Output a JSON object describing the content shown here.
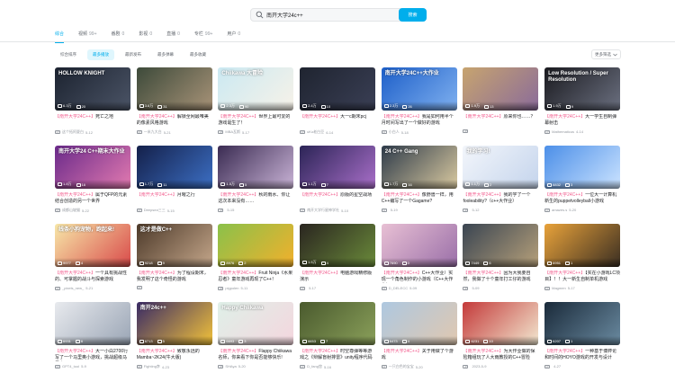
{
  "search": {
    "value": "南开大学24c++",
    "button_label": "搜索"
  },
  "tabs": [
    {
      "label": "综合",
      "count": "",
      "active": true
    },
    {
      "label": "视频",
      "count": "99+",
      "active": false
    },
    {
      "label": "番剧",
      "count": "0",
      "active": false
    },
    {
      "label": "影视",
      "count": "0",
      "active": false
    },
    {
      "label": "直播",
      "count": "0",
      "active": false
    },
    {
      "label": "专栏",
      "count": "99+",
      "active": false
    },
    {
      "label": "用户",
      "count": "0",
      "active": false
    }
  ],
  "filters": [
    {
      "label": "综合排序",
      "active": false
    },
    {
      "label": "最多播放",
      "active": true
    },
    {
      "label": "最新发布",
      "active": false
    },
    {
      "label": "最多弹幕",
      "active": false
    },
    {
      "label": "最多收藏",
      "active": false
    }
  ],
  "more_filter": "更多筛选",
  "videos": [
    {
      "hl": "【南开大学24C++】",
      "title": "死亡之地",
      "up": "这个拓阿夏白",
      "date": "5-12",
      "plays": "6.3万",
      "danmu": "20",
      "dur": "",
      "thumb": [
        "#1c2330",
        "#4b5466"
      ],
      "label": "HOLLOW KNIGHT"
    },
    {
      "hl": "【南开大学24C++】",
      "title": "解锁全网最唯美的像素风格游戏",
      "up": "一米九大白",
      "date": "5-21",
      "plays": "3.6万",
      "danmu": "31",
      "dur": "",
      "thumb": [
        "#3d4a3a",
        "#a89378"
      ],
      "label": ""
    },
    {
      "hl": "【南开大学24C++】",
      "title": "世界上最可爱的游戏诞生了！",
      "up": "MBA瓦斯",
      "date": "5-17",
      "plays": "2.3万",
      "danmu": "90",
      "dur": "",
      "thumb": [
        "#cbe9f2",
        "#f7f2e8"
      ],
      "label": "Chiikawa 大冒险"
    },
    {
      "hl": "【南开大学24C++】",
      "title": "大一c期末pcj",
      "up": "uKo老白豆",
      "date": "6-14",
      "plays": "2.4万",
      "danmu": "10",
      "dur": "",
      "thumb": [
        "#1f2430",
        "#3a3f55"
      ],
      "label": ""
    },
    {
      "hl": "【南开大学24C++】",
      "title": "我是如何用半个月时间写出了一个做好的游戏",
      "up": "小白人",
      "date": "5-18",
      "plays": "2.3万",
      "danmu": "26",
      "dur": "",
      "thumb": [
        "#1d5fc9",
        "#7fb0ef"
      ],
      "label": "南开大学24C++大作业"
    },
    {
      "hl": "【南开大学24C++】",
      "title": "原来你也……？",
      "up": "",
      "date": "",
      "plays": "1.9万",
      "danmu": "13",
      "dur": "",
      "thumb": [
        "#c7a46f",
        "#8a6b9a"
      ],
      "label": ""
    },
    {
      "hl": "【南开大学24C++】",
      "title": "大一学生自制弹幕射击",
      "up": "Mathematicus",
      "date": "4-14",
      "plays": "1.9万",
      "danmu": "9",
      "dur": "",
      "thumb": [
        "#1a1a1f",
        "#6b7080"
      ],
      "label": "Low Resolution / Super Resolution"
    },
    {
      "hl": "【南开大学24C++】",
      "title": "属于QFP的元素结合创造的另一个世界",
      "up": "成都山坡猫",
      "date": "5-22",
      "plays": "1.8万",
      "danmu": "16",
      "dur": "",
      "thumb": [
        "#6a2a8a",
        "#e27ab0"
      ],
      "label": "南开大学24 C++期末大作业"
    },
    {
      "hl": "【南开大学24C++】",
      "title": "月曜之行",
      "up": "Deepsea三三",
      "date": "5-15",
      "plays": "1.7万",
      "danmu": "11",
      "dur": "",
      "thumb": [
        "#14204a",
        "#3c6fc4"
      ],
      "label": ""
    },
    {
      "hl": "【南开大学24C++】",
      "title": "秋的雨水、你让这次本来没有……",
      "up": "",
      "date": "5-15",
      "plays": "1.5万",
      "danmu": "5",
      "dur": "",
      "thumb": [
        "#3a2b52",
        "#c9b3d6"
      ],
      "label": ""
    },
    {
      "hl": "【南开大学24C++】",
      "title": "原版的星空战场",
      "up": "南开大学行星神学社",
      "date": "5-10",
      "plays": "1.1万",
      "danmu": "7",
      "dur": "",
      "thumb": [
        "#2b2456",
        "#a96fc9"
      ],
      "label": ""
    },
    {
      "hl": "【南开大学24C++】",
      "title": "像野兽一样，用C++编写了一个Gagame?",
      "up": "",
      "date": "5-19",
      "plays": "1.7万",
      "danmu": "16",
      "dur": "",
      "thumb": [
        "#2e3b4a",
        "#d9c9a0"
      ],
      "label": "24 C++ Gang"
    },
    {
      "hl": "【南开大学24C++】",
      "title": "我的学了一个fooleability?（c++大作业）",
      "up": "",
      "date": "5-12",
      "plays": "1.1万",
      "danmu": "2",
      "dur": "",
      "thumb": [
        "#f3f6fb",
        "#c4d4ec"
      ],
      "label": "我的学习!"
    },
    {
      "hl": "【南开大学24C++】",
      "title": "一位大一计算机新生的puppetvolleyball小游戏",
      "up": "amazes.s",
      "date": "5-20",
      "plays": "8832",
      "danmu": "3",
      "dur": "",
      "thumb": [
        "#4c8fe8",
        "#cbe3ff"
      ],
      "label": ""
    },
    {
      "hl": "【南开大学24C++】",
      "title": "一个具有挑战性的、可掌握的战斗与探索游戏",
      "up": "_pixels_new_",
      "date": "5-21",
      "plays": "9977",
      "danmu": "4",
      "dur": "",
      "thumb": [
        "#f7e7a8",
        "#d94a4a"
      ],
      "label": "线条小狗宠物，跑起来!"
    },
    {
      "hl": "【南开大学24C++】",
      "title": "为了程设期末，我发明了这个奇怪的游戏",
      "up": "",
      "date": "",
      "plays": "9218",
      "danmu": "9",
      "dur": "",
      "thumb": [
        "#4d3a2a",
        "#c4a68a"
      ],
      "label": "这才是做C++"
    },
    {
      "hl": "【南开大学24C++】",
      "title": "Fruit Ninja《水果忍者》童年游戏再现了C++！",
      "up": "pigpolen",
      "date": "5-11",
      "plays": "8976",
      "danmu": "2",
      "dur": "",
      "thumb": [
        "#8ac14a",
        "#f2b02c"
      ],
      "label": ""
    },
    {
      "hl": "【南开大学24C++】",
      "title": "电脑游戏精修版演示",
      "up": "",
      "date": "5-17",
      "plays": "1.5万",
      "danmu": "4",
      "dur": "",
      "thumb": [
        "#2a2520",
        "#6a8a3a"
      ],
      "label": ""
    },
    {
      "hl": "【南开大学24C++】",
      "title": "C++大作业）实现一个角色制作的小游戏（C++大作业）",
      "up": "D_DELECC",
      "date": "5-09",
      "plays": "7690",
      "danmu": "0",
      "dur": "",
      "thumb": [
        "#e8c0d4",
        "#9a6fa8"
      ],
      "label": ""
    },
    {
      "hl": "【南开大学24C++】",
      "title": "因为大我要自然，我做了十个童年打工仔的游戏",
      "up": "",
      "date": "5-09",
      "plays": "7449",
      "danmu": "6",
      "dur": "",
      "thumb": [
        "#3a4552",
        "#b6a07a"
      ],
      "label": ""
    },
    {
      "hl": "【南开大学24C++】",
      "title": "【实在小游戏LC项目】！！大一新生自制单机游戏",
      "up": "Magmen",
      "date": "5-17",
      "plays": "6951",
      "danmu": "1",
      "dur": "",
      "thumb": [
        "#e8a23a",
        "#3a2e22"
      ],
      "label": ""
    },
    {
      "hl": "【南开大学24C++】",
      "title": "大一小白2700行写了一个马里奥小游戏，挑战超级马里奥",
      "up": "GPT4_tool",
      "date": "5-9",
      "plays": "6931",
      "danmu": "6",
      "dur": "",
      "thumb": [
        "#e8eaee",
        "#9aa5b5"
      ],
      "label": ""
    },
    {
      "hl": "【南开大学24C++】",
      "title": "致敬永远的Mamba~2K24(牛大版)",
      "up": "Fighting李",
      "date": "4-23",
      "plays": "6713",
      "danmu": "5",
      "dur": "",
      "thumb": [
        "#3a2b66",
        "#f2c23a"
      ],
      "label": "南开24c++"
    },
    {
      "hl": "【南开大学24C++】",
      "title": "Flappy Chiikawa 名师，你来看下你是否能够快乐!",
      "up": "SHAya",
      "date": "5-20",
      "plays": "6693",
      "danmu": "3",
      "dur": "",
      "thumb": [
        "#dff0e8",
        "#f4d6de"
      ],
      "label": "Happy Chiikawa"
    },
    {
      "hl": "【南开大学24C++】",
      "title": "时空尊弹等等游戏之《辩解盲射排雷》unity程序代码",
      "up": "D_fang悠",
      "date": "5-16",
      "plays": "6653",
      "danmu": "7",
      "dur": "",
      "thumb": [
        "#4a5a2e",
        "#8aa05a"
      ],
      "label": ""
    },
    {
      "hl": "【南开大学24C++】",
      "title": "关于用做了个游戏",
      "up": "一只白色的宝宝",
      "date": "5-20",
      "plays": "6473",
      "danmu": "4",
      "dur": "",
      "thumb": [
        "#aec8e0",
        "#e0c8b0"
      ],
      "label": ""
    },
    {
      "hl": "【南开大学24C++】",
      "title": "为大作业做的保险箱组玩了人大雨教授的C++冒险",
      "up": "",
      "date": "2023-5-9",
      "plays": "6231",
      "danmu": "10",
      "dur": "",
      "thumb": [
        "#c43a3a",
        "#f2e8d0"
      ],
      "label": ""
    },
    {
      "hl": "【南开大学24C++】",
      "title": "一种基于博弈论和时间的HOYO游戏的开发与设计",
      "up": "",
      "date": "4-27",
      "plays": "6207",
      "danmu": "1",
      "dur": "",
      "thumb": [
        "#1a2a3a",
        "#6a8aa0"
      ],
      "label": ""
    }
  ]
}
